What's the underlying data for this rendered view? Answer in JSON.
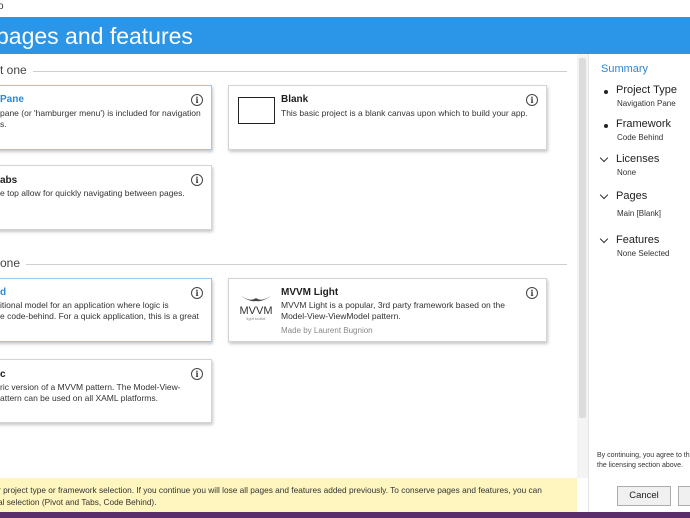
{
  "window": {
    "title": "o",
    "header": "pages and features"
  },
  "sections": [
    {
      "label": "t one"
    },
    {
      "label": "one"
    }
  ],
  "project_types": [
    {
      "title": "Pane",
      "lines": [
        "pane (or 'hamburger menu') is included for navigation",
        "s."
      ],
      "selected": true
    },
    {
      "title": "Blank",
      "lines": [
        "This basic project is a blank canvas upon which to build your app."
      ],
      "selected": false
    },
    {
      "title": "abs",
      "lines": [
        "e top allow for quickly navigating between pages."
      ],
      "selected": false
    }
  ],
  "frameworks": [
    {
      "title": "d",
      "lines": [
        "itional model for an application where logic is",
        "e code-behind.  For a quick application, this is a great"
      ],
      "selected": true
    },
    {
      "title": "MVVM Light",
      "lines": [
        "MVVM Light is a popular, 3rd party framework based on the",
        "Model-View-ViewModel pattern."
      ],
      "author": "Made by Laurent Bugnion",
      "logo_text": "MVVM",
      "logo_subtext": "light toolkit",
      "selected": false
    },
    {
      "title": "c",
      "lines": [
        "ric version of a MVVM pattern. The Model-View-",
        "attern can be used on all XAML platforms."
      ],
      "selected": false
    }
  ],
  "info_icon": "i",
  "summary": {
    "heading": "Summary",
    "items": [
      {
        "key": "Project Type",
        "value": "Navigation Pane",
        "marker": "bullet"
      },
      {
        "key": "Framework",
        "value": "Code Behind",
        "marker": "bullet"
      },
      {
        "key": "Licenses",
        "value": "None",
        "marker": "chevron"
      },
      {
        "key": "Pages",
        "value": "Main [Blank]",
        "marker": "chevron"
      },
      {
        "key": "Features",
        "value": "None Selected",
        "marker": "chevron"
      }
    ],
    "consent_line1": "By continuing, you agree to th",
    "consent_line2": "the licensing section above."
  },
  "warning": {
    "line1": "r project type or framework selection. If you continue you will lose all pages and features added previously. To conserve pages and features, you can",
    "line2": "al selection (Pivot and Tabs, Code Behind)."
  },
  "buttons": {
    "cancel": "Cancel"
  },
  "colors": {
    "accent": "#2b96e7",
    "summary_heading": "#2b88d8",
    "warning_bg": "#fff6bf",
    "taskbar": "#5a2d6b"
  }
}
